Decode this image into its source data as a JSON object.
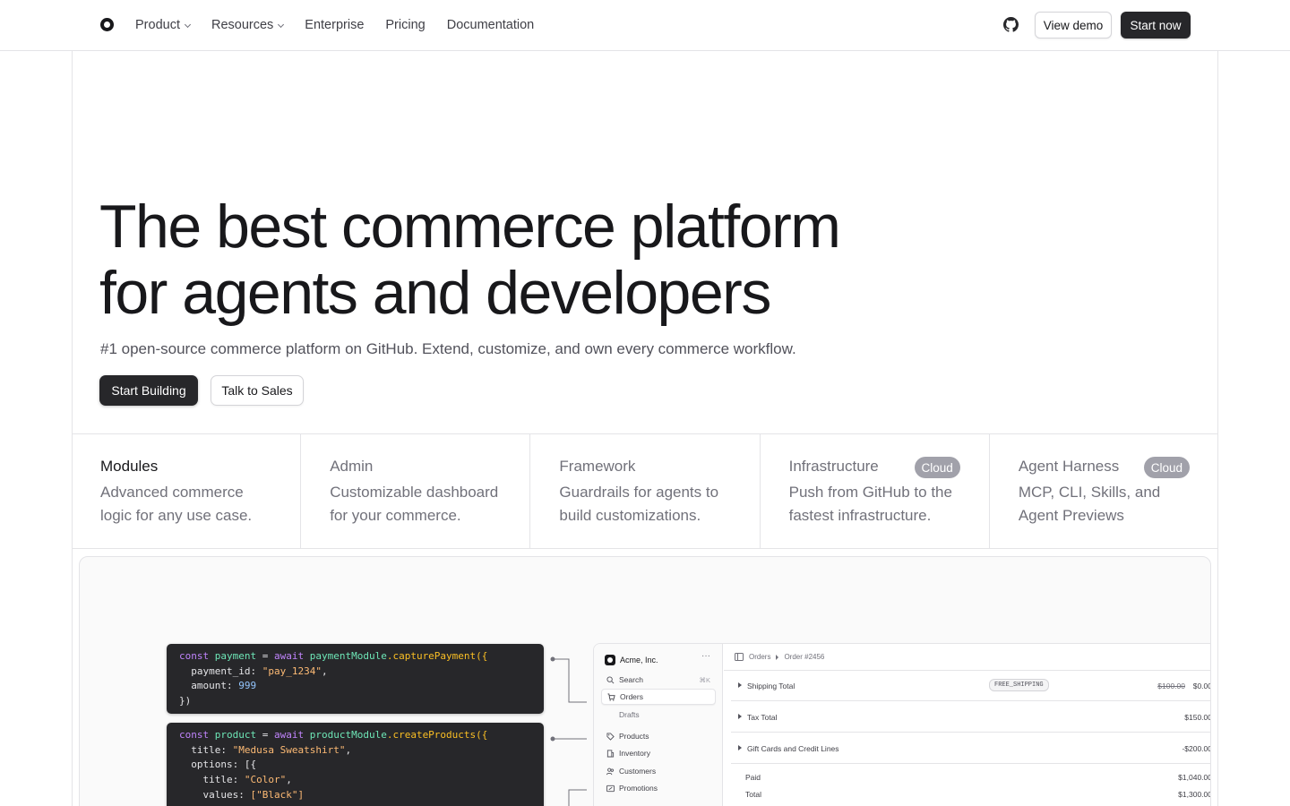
{
  "nav": {
    "links": [
      {
        "label": "Product",
        "dropdown": true
      },
      {
        "label": "Resources",
        "dropdown": true
      },
      {
        "label": "Enterprise",
        "dropdown": false
      },
      {
        "label": "Pricing",
        "dropdown": false
      },
      {
        "label": "Documentation",
        "dropdown": false
      }
    ],
    "github_icon": "github-icon",
    "view_demo": "View demo",
    "start_now": "Start now"
  },
  "hero": {
    "title_line1": "The best commerce platform",
    "title_line2": "for agents and developers",
    "subtitle": "#1 open-source commerce platform on GitHub. Extend, customize, and own every commerce workflow.",
    "primary_cta": "Start Building",
    "secondary_cta": "Talk to Sales"
  },
  "features": [
    {
      "title": "Modules",
      "desc_line1": "Advanced commerce",
      "desc_line2": "logic for any use case.",
      "badge": "",
      "active": true
    },
    {
      "title": "Admin",
      "desc_line1": "Customizable dashboard",
      "desc_line2": "for your commerce.",
      "badge": "",
      "active": false
    },
    {
      "title": "Framework",
      "desc_line1": "Guardrails for agents to",
      "desc_line2": "build customizations.",
      "badge": "",
      "active": false
    },
    {
      "title": "Infrastructure",
      "desc_line1": "Push from GitHub to the",
      "desc_line2": "fastest infrastructure.",
      "badge": "Cloud",
      "active": false
    },
    {
      "title": "Agent Harness",
      "desc_line1": "MCP, CLI, Skills, and",
      "desc_line2": "Agent Previews",
      "badge": "Cloud",
      "active": false
    }
  ],
  "preview": {
    "code1": {
      "l1": [
        "const",
        "payment",
        "=",
        "await",
        "paymentModule",
        ".capturePayment({"
      ],
      "l2": [
        "payment_id:",
        "\"pay_1234\"",
        ","
      ],
      "l3": [
        "amount:",
        "999"
      ],
      "l4": "})"
    },
    "code2": {
      "l1": [
        "const",
        "product",
        "=",
        "await",
        "productModule",
        ".createProducts({"
      ],
      "l2": [
        "title:",
        "\"Medusa Sweatshirt\"",
        ","
      ],
      "l3": "options: [{",
      "l4": [
        "title:",
        "\"Color\"",
        ","
      ],
      "l5": [
        "values:",
        "[\"Black\"]"
      ]
    },
    "admin": {
      "brand": "Acme, Inc.",
      "more": "···",
      "nav": [
        {
          "label": "Search",
          "shortcut": "⌘K",
          "icon": "search-icon"
        },
        {
          "label": "Orders",
          "icon": "cart-icon",
          "selected": true
        },
        {
          "label": "Drafts",
          "icon": ""
        },
        {
          "label": "Products",
          "icon": "tag-icon"
        },
        {
          "label": "Inventory",
          "icon": "building-icon"
        },
        {
          "label": "Customers",
          "icon": "users-icon"
        },
        {
          "label": "Promotions",
          "icon": "percent-icon"
        }
      ],
      "crumb": [
        "Orders",
        "Order #2456"
      ],
      "rows": [
        {
          "label": "Shipping Total",
          "tag": "FREE_SHIPPING",
          "old": "$100.00",
          "amount": "$0.00"
        },
        {
          "label": "Tax Total",
          "amount": "$150.00"
        },
        {
          "label": "Gift Cards and Credit Lines",
          "amount": "-$200.00"
        }
      ],
      "totals": [
        {
          "label": "Paid",
          "amount": "$1,040.00"
        },
        {
          "label": "Total",
          "amount": "$1,300.00"
        }
      ]
    }
  }
}
